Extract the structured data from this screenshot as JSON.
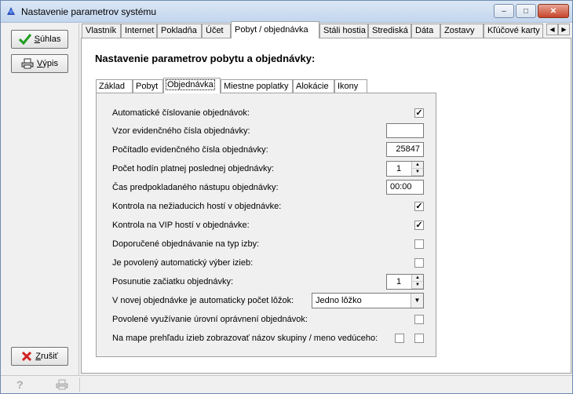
{
  "window": {
    "title": "Nastavenie parametrov systému",
    "controls": {
      "minimize": "–",
      "maximize": "□",
      "close": "✕"
    }
  },
  "sidebar": {
    "ok": {
      "label_u": "S",
      "label_rest": "úhlas",
      "icon": "checkmark-icon"
    },
    "print": {
      "label_u": "V",
      "label_rest": "ýpis",
      "icon": "printer-icon"
    },
    "cancel": {
      "label_u": "Z",
      "label_rest": "rušiť",
      "icon": "x-icon"
    }
  },
  "tabs": [
    "Vlastník",
    "Internet",
    "Pokladňa",
    "Účet",
    "Pobyt / objednávka",
    "Stáli hostia",
    "Strediská",
    "Dáta",
    "Zostavy",
    "Kľúčové karty"
  ],
  "active_tab": "Pobyt / objednávka",
  "heading": "Nastavenie parametrov pobytu a objednávky:",
  "subtabs": [
    "Základ",
    "Pobyt",
    "Objednávka",
    "Miestne poplatky",
    "Alokácie",
    "Ikony"
  ],
  "active_subtab": "Objednávka",
  "settings": {
    "auto_numbering": {
      "label": "Automatické číslovanie objednávok:",
      "checked": "✓"
    },
    "number_pattern": {
      "label": "Vzor evidenčného čísla objednávky:",
      "value": ""
    },
    "counter": {
      "label": "Počítadlo evidenčného čísla objednávky:",
      "value": "25847"
    },
    "valid_hours": {
      "label": "Počet hodín platnej poslednej objednávky:",
      "value": "1"
    },
    "arrival_time": {
      "label": "Čas predpokladaného nástupu objednávky:",
      "value": "00:00"
    },
    "unwanted_guests": {
      "label": "Kontrola na nežiaducich hostí v objednávke:",
      "checked": "✓"
    },
    "vip_guests": {
      "label": "Kontrola na VIP hostí v objednávke:",
      "checked": "✓"
    },
    "recommended_room": {
      "label": "Doporučené objednávanie na typ izby:",
      "checked": ""
    },
    "auto_room_select": {
      "label": "Je povolený automatický výber izieb:",
      "checked": ""
    },
    "start_shift": {
      "label": "Posunutie začiatku objednávky:",
      "value": "1"
    },
    "beds_count": {
      "label": "V novej objednávke je automaticky počet lôžok:",
      "value": "Jedno lôžko"
    },
    "permission_levels": {
      "label": "Povolené využívanie úrovní oprávnení objednávok:",
      "checked": ""
    },
    "map_group_name": {
      "label": "Na mape prehľadu izieb zobrazovať názov skupiny / meno vedúceho:",
      "checked_a": "",
      "checked_b": ""
    }
  },
  "statusbar": {
    "help_icon": "help-icon",
    "print_icon": "printer-icon"
  },
  "colors": {
    "panel_bg": "#f0f0f0",
    "content_bg": "#ffffff",
    "border": "#a0a0a0"
  }
}
